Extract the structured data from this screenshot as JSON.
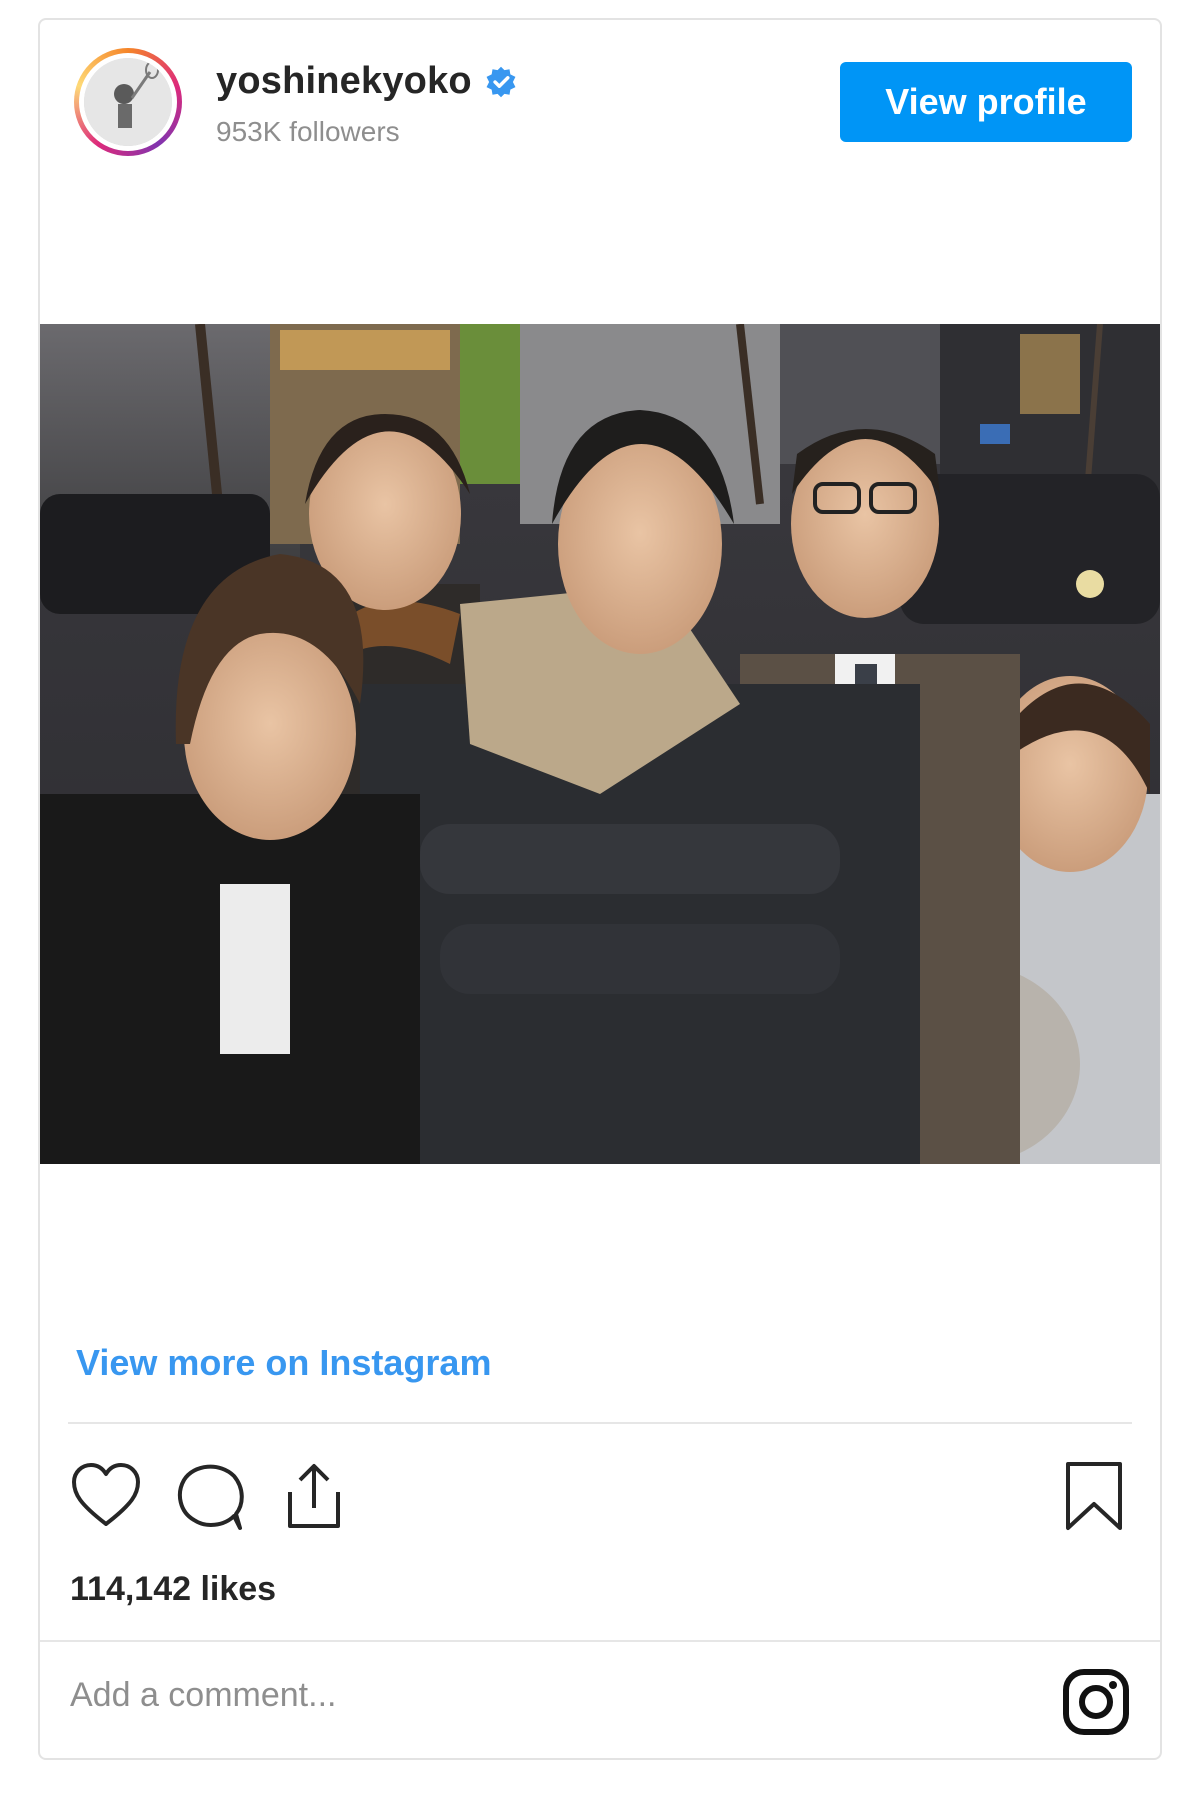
{
  "header": {
    "username": "yoshinekyoko",
    "followers": "953K followers",
    "view_profile_label": "View profile",
    "verified_icon": "verified-badge-icon",
    "brand_blue": "#0095f6"
  },
  "post": {
    "photo_alt": "Group photo of five people outdoors at night on a city street",
    "view_more_label": "View more on Instagram",
    "likes": "114,142 likes"
  },
  "actions": {
    "like_icon": "heart-icon",
    "comment_icon": "comment-icon",
    "share_icon": "share-icon",
    "save_icon": "bookmark-icon"
  },
  "comment": {
    "placeholder": "Add a comment..."
  },
  "footer": {
    "brand_icon": "instagram-logo-icon"
  },
  "colors": {
    "link_blue": "#3897f0",
    "text_dark": "#262626",
    "text_muted": "#8e8e8e"
  }
}
